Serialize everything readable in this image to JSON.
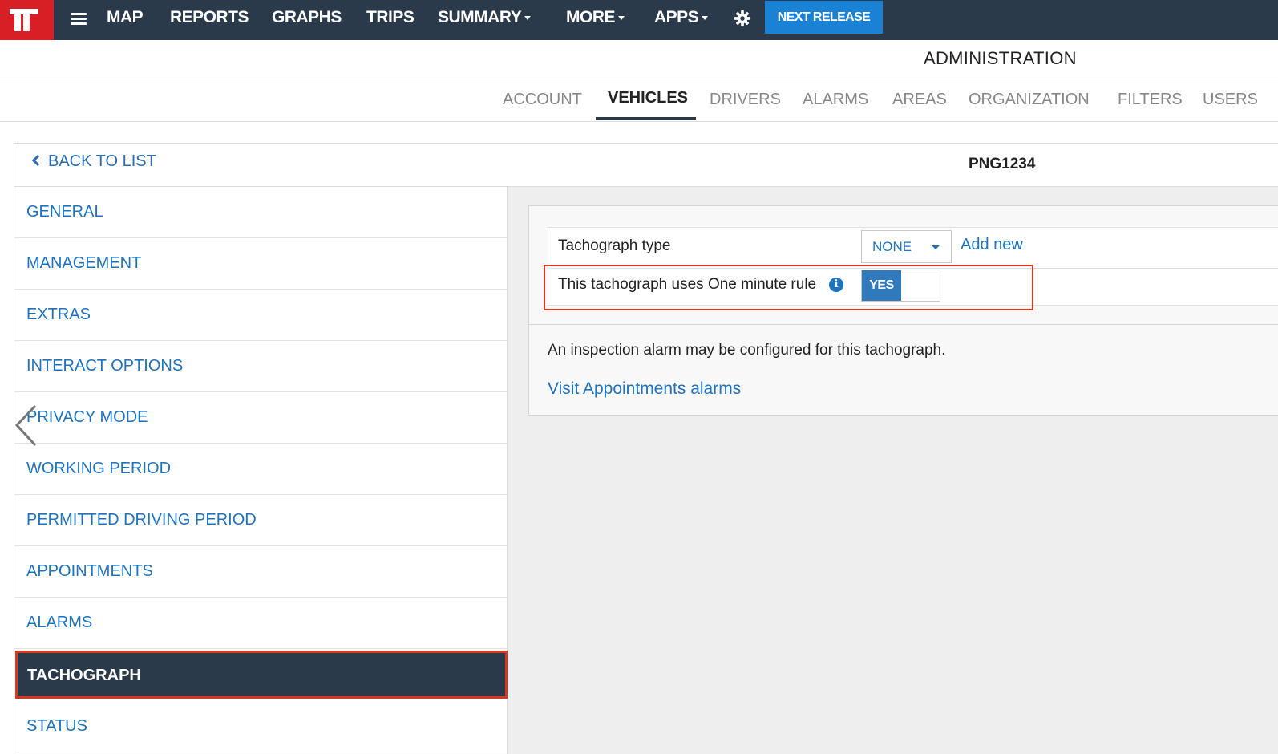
{
  "topbar": {
    "nav": [
      "MAP",
      "REPORTS",
      "GRAPHS",
      "TRIPS",
      "SUMMARY",
      "MORE",
      "APPS"
    ],
    "next_release": "NEXT RELEASE"
  },
  "page": {
    "title": "ADMINISTRATION",
    "tabs": [
      "ACCOUNT",
      "VEHICLES",
      "DRIVERS",
      "ALARMS",
      "AREAS",
      "ORGANIZATION",
      "FILTERS",
      "USERS"
    ],
    "active_tab": "VEHICLES"
  },
  "vehicle": {
    "back_label": "BACK TO LIST",
    "plate": "PNG1234"
  },
  "sidebar": {
    "items": [
      {
        "label": "GENERAL"
      },
      {
        "label": "MANAGEMENT"
      },
      {
        "label": "EXTRAS"
      },
      {
        "label": "INTERACT OPTIONS"
      },
      {
        "label": "PRIVACY MODE"
      },
      {
        "label": "WORKING PERIOD"
      },
      {
        "label": "PERMITTED DRIVING PERIOD"
      },
      {
        "label": "APPOINTMENTS"
      },
      {
        "label": "ALARMS"
      },
      {
        "label": "TACHOGRAPH"
      },
      {
        "label": "STATUS"
      }
    ],
    "active": "TACHOGRAPH"
  },
  "tachograph": {
    "type_label": "Tachograph type",
    "type_value": "NONE",
    "add_new": "Add new",
    "rule_label": "This tachograph uses One minute rule",
    "toggle_value": "YES",
    "info_note": "An inspection alarm may be configured for this tachograph.",
    "visit_link": "Visit Appointments alarms"
  },
  "colors": {
    "topbar": "#2b3a4a",
    "brand_red": "#d81f26",
    "accent_blue": "#1a82d4",
    "link_blue": "#1e73be",
    "highlight": "#d9381e"
  }
}
